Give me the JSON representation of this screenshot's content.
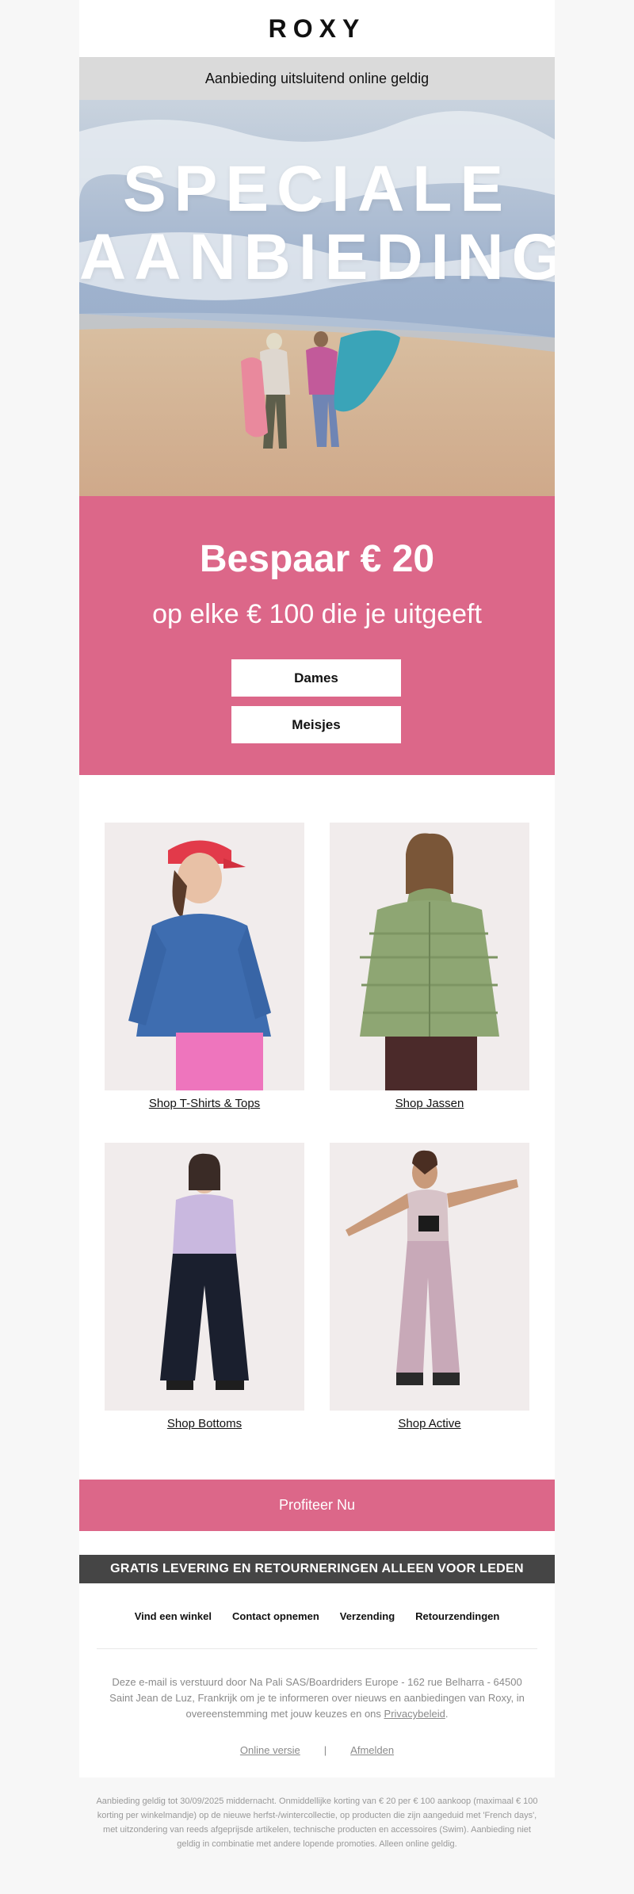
{
  "brand": {
    "logo": "ROXY"
  },
  "notice": "Aanbieding uitsluitend online geldig",
  "hero": {
    "line1": "SPECIALE",
    "line2": "AANBIEDING"
  },
  "promo": {
    "save": "Bespaar € 20",
    "sub": "op elke € 100 die je uitgeeft",
    "buttons": [
      "Dames",
      "Meisjes"
    ],
    "color": "#dc6789"
  },
  "products": [
    {
      "label": "Shop T-Shirts & Tops"
    },
    {
      "label": "Shop Jassen"
    },
    {
      "label": "Shop Bottoms"
    },
    {
      "label": "Shop Active"
    }
  ],
  "cta": "Profiteer Nu",
  "shipping": "GRATIS LEVERING EN RETOURNERINGEN ALLEEN VOOR LEDEN",
  "links": [
    "Vind een winkel",
    "Contact opnemen",
    "Verzending",
    "Retourzendingen"
  ],
  "legal": {
    "text": "Deze e-mail is verstuurd door Na Pali SAS/Boardriders Europe - 162 rue Belharra - 64500 Saint Jean de Luz, Frankrijk om je te informeren over nieuws en aanbiedingen van Roxy, in overeenstemming met jouw keuzes en ons",
    "privacy": "Privacybeleid",
    "period": "."
  },
  "footer": {
    "online": "Online versie",
    "separator": "|",
    "unsubscribe": "Afmelden"
  },
  "fineprint": "Aanbieding geldig tot 30/09/2025 middernacht. Onmiddellijke korting van € 20 per € 100 aankoop (maximaal € 100 korting per winkelmandje) op de nieuwe herfst-/wintercollectie, op producten die zijn aangeduid met 'French days', met uitzondering van reeds afgeprijsde artikelen, technische producten en accessoires (Swim). Aanbieding niet geldig in combinatie met andere lopende promoties. Alleen online geldig."
}
